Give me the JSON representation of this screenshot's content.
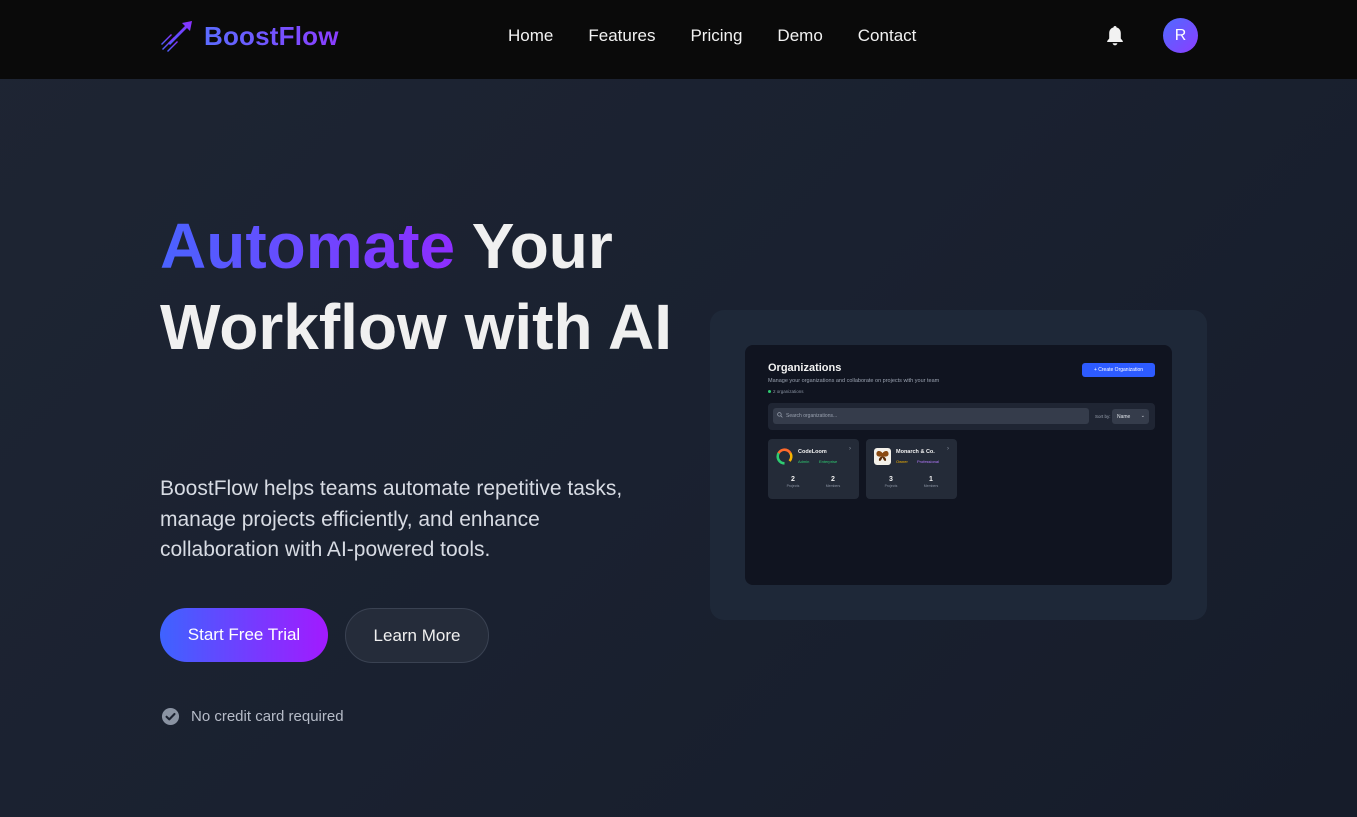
{
  "nav": {
    "brand": "BoostFlow",
    "links": [
      "Home",
      "Features",
      "Pricing",
      "Demo",
      "Contact"
    ],
    "avatar_initial": "R",
    "brand_gradient": [
      "#5b6cff",
      "#8b3dff"
    ]
  },
  "hero": {
    "title_accent": "Automate",
    "title_rest": " Your Workflow with AI",
    "description": "BoostFlow helps teams automate repetitive tasks, manage projects efficiently, and enhance collaboration with AI-powered tools.",
    "primary_cta": "Start Free Trial",
    "secondary_cta": "Learn More",
    "note": "No credit card required"
  },
  "preview": {
    "title": "Organizations",
    "subtitle": "Manage your organizations and collaborate on projects with your team",
    "count_label": "2 organizations",
    "create_button": "+ Create Organization",
    "search_placeholder": "Search organizations...",
    "sort_label": "Sort by:",
    "sort_value": "Name",
    "orgs": [
      {
        "name": "CodeLoom",
        "role": "Admin",
        "plan": "Enterprise",
        "projects": "2",
        "projects_label": "Projects",
        "members": "2",
        "members_label": "Members"
      },
      {
        "name": "Monarch & Co.",
        "role": "Owner",
        "plan": "Professional",
        "projects": "3",
        "projects_label": "Projects",
        "members": "1",
        "members_label": "Members"
      }
    ]
  },
  "icons": [
    "rocket-logo-icon",
    "bell-icon",
    "check-circle-icon",
    "search-icon",
    "chevron-right-icon",
    "chevron-down-icon"
  ]
}
